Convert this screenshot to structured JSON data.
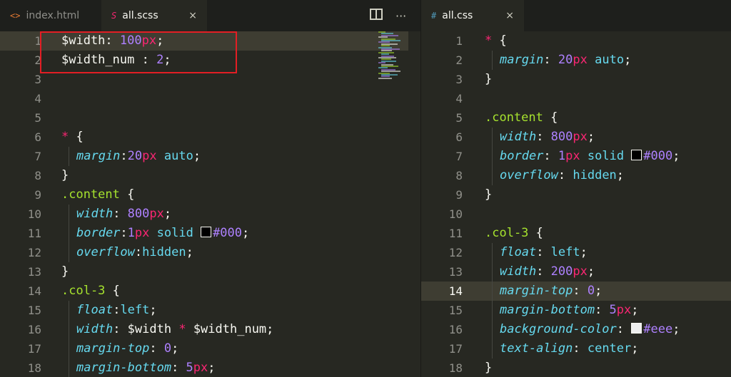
{
  "left_tabs": [
    {
      "icon": "<>",
      "label": "index.html",
      "active": false
    },
    {
      "icon": "S",
      "label": "all.scss",
      "active": true,
      "close": "×"
    }
  ],
  "left_actions": {
    "split": "split-editor-icon",
    "more": "···"
  },
  "right_tabs": [
    {
      "icon": "#",
      "label": "all.css",
      "active": true,
      "close": "×"
    }
  ],
  "colors": {
    "background": "#272822",
    "highlight_box": "#e31e24",
    "property": "#66d9ef",
    "selector": "#a6e22e",
    "number": "#ae81ff",
    "unit": "#f92672"
  },
  "left_editor": {
    "lines": [
      {
        "n": "1",
        "tokens": [
          [
            "var",
            "$width"
          ],
          [
            "punc",
            ": "
          ],
          [
            "num",
            "100"
          ],
          [
            "unit",
            "px"
          ],
          [
            "punc",
            ";"
          ]
        ],
        "indent": 0,
        "highlight": true
      },
      {
        "n": "2",
        "tokens": [
          [
            "var",
            "$width_num"
          ],
          [
            "punc",
            " : "
          ],
          [
            "num",
            "2"
          ],
          [
            "punc",
            ";"
          ]
        ],
        "indent": 0
      },
      {
        "n": "3",
        "tokens": [],
        "indent": 0
      },
      {
        "n": "4",
        "tokens": [],
        "indent": 0
      },
      {
        "n": "5",
        "tokens": [],
        "indent": 0
      },
      {
        "n": "6",
        "tokens": [
          [
            "star",
            "*"
          ],
          [
            "punc",
            " {"
          ]
        ],
        "indent": 0
      },
      {
        "n": "7",
        "tokens": [
          [
            "prop",
            "margin"
          ],
          [
            "punc",
            ":"
          ],
          [
            "num",
            "20"
          ],
          [
            "unit",
            "px"
          ],
          [
            "val",
            " auto"
          ],
          [
            "punc",
            ";"
          ]
        ],
        "indent": 1
      },
      {
        "n": "8",
        "tokens": [
          [
            "punc",
            "}"
          ]
        ],
        "indent": 0
      },
      {
        "n": "9",
        "tokens": [
          [
            "sel",
            ".content"
          ],
          [
            "punc",
            " {"
          ]
        ],
        "indent": 0
      },
      {
        "n": "10",
        "tokens": [
          [
            "prop",
            "width"
          ],
          [
            "punc",
            ": "
          ],
          [
            "num",
            "800"
          ],
          [
            "unit",
            "px"
          ],
          [
            "punc",
            ";"
          ]
        ],
        "indent": 1
      },
      {
        "n": "11",
        "tokens": [
          [
            "prop",
            "border"
          ],
          [
            "punc",
            ":"
          ],
          [
            "num",
            "1"
          ],
          [
            "unit",
            "px"
          ],
          [
            "val",
            " solid "
          ],
          [
            "swatch",
            "#000"
          ],
          [
            "num",
            "#000"
          ],
          [
            "punc",
            ";"
          ]
        ],
        "indent": 1
      },
      {
        "n": "12",
        "tokens": [
          [
            "prop",
            "overflow"
          ],
          [
            "punc",
            ":"
          ],
          [
            "val",
            "hidden"
          ],
          [
            "punc",
            ";"
          ]
        ],
        "indent": 1
      },
      {
        "n": "13",
        "tokens": [
          [
            "punc",
            "}"
          ]
        ],
        "indent": 0
      },
      {
        "n": "14",
        "tokens": [
          [
            "sel",
            ".col-3"
          ],
          [
            "punc",
            " {"
          ]
        ],
        "indent": 0
      },
      {
        "n": "15",
        "tokens": [
          [
            "prop",
            "float"
          ],
          [
            "punc",
            ":"
          ],
          [
            "val",
            "left"
          ],
          [
            "punc",
            ";"
          ]
        ],
        "indent": 1
      },
      {
        "n": "16",
        "tokens": [
          [
            "prop",
            "width"
          ],
          [
            "punc",
            ": "
          ],
          [
            "var",
            "$width"
          ],
          [
            "op",
            " * "
          ],
          [
            "var",
            "$width_num"
          ],
          [
            "punc",
            ";"
          ]
        ],
        "indent": 1
      },
      {
        "n": "17",
        "tokens": [
          [
            "prop",
            "margin-top"
          ],
          [
            "punc",
            ": "
          ],
          [
            "num",
            "0"
          ],
          [
            "punc",
            ";"
          ]
        ],
        "indent": 1
      },
      {
        "n": "18",
        "tokens": [
          [
            "prop",
            "margin-bottom"
          ],
          [
            "punc",
            ": "
          ],
          [
            "num",
            "5"
          ],
          [
            "unit",
            "px"
          ],
          [
            "punc",
            ";"
          ]
        ],
        "indent": 1
      }
    ]
  },
  "right_editor": {
    "lines": [
      {
        "n": "1",
        "tokens": [
          [
            "star",
            "*"
          ],
          [
            "punc",
            " {"
          ]
        ],
        "indent": 0
      },
      {
        "n": "2",
        "tokens": [
          [
            "prop",
            "margin"
          ],
          [
            "punc",
            ": "
          ],
          [
            "num",
            "20"
          ],
          [
            "unit",
            "px"
          ],
          [
            "val",
            " auto"
          ],
          [
            "punc",
            ";"
          ]
        ],
        "indent": 1
      },
      {
        "n": "3",
        "tokens": [
          [
            "punc",
            "}"
          ]
        ],
        "indent": 0
      },
      {
        "n": "4",
        "tokens": [],
        "indent": 0
      },
      {
        "n": "5",
        "tokens": [
          [
            "sel",
            ".content"
          ],
          [
            "punc",
            " {"
          ]
        ],
        "indent": 0
      },
      {
        "n": "6",
        "tokens": [
          [
            "prop",
            "width"
          ],
          [
            "punc",
            ": "
          ],
          [
            "num",
            "800"
          ],
          [
            "unit",
            "px"
          ],
          [
            "punc",
            ";"
          ]
        ],
        "indent": 1
      },
      {
        "n": "7",
        "tokens": [
          [
            "prop",
            "border"
          ],
          [
            "punc",
            ": "
          ],
          [
            "num",
            "1"
          ],
          [
            "unit",
            "px"
          ],
          [
            "val",
            " solid "
          ],
          [
            "swatch",
            "#000"
          ],
          [
            "num",
            "#000"
          ],
          [
            "punc",
            ";"
          ]
        ],
        "indent": 1
      },
      {
        "n": "8",
        "tokens": [
          [
            "prop",
            "overflow"
          ],
          [
            "punc",
            ": "
          ],
          [
            "val",
            "hidden"
          ],
          [
            "punc",
            ";"
          ]
        ],
        "indent": 1
      },
      {
        "n": "9",
        "tokens": [
          [
            "punc",
            "}"
          ]
        ],
        "indent": 0
      },
      {
        "n": "10",
        "tokens": [],
        "indent": 0
      },
      {
        "n": "11",
        "tokens": [
          [
            "sel",
            ".col-3"
          ],
          [
            "punc",
            " {"
          ]
        ],
        "indent": 0
      },
      {
        "n": "12",
        "tokens": [
          [
            "prop",
            "float"
          ],
          [
            "punc",
            ": "
          ],
          [
            "val",
            "left"
          ],
          [
            "punc",
            ";"
          ]
        ],
        "indent": 1
      },
      {
        "n": "13",
        "tokens": [
          [
            "prop",
            "width"
          ],
          [
            "punc",
            ": "
          ],
          [
            "num",
            "200"
          ],
          [
            "unit",
            "px"
          ],
          [
            "punc",
            ";"
          ]
        ],
        "indent": 1
      },
      {
        "n": "14",
        "tokens": [
          [
            "prop",
            "margin-top"
          ],
          [
            "punc",
            ": "
          ],
          [
            "num",
            "0"
          ],
          [
            "punc",
            ";"
          ]
        ],
        "indent": 1,
        "highlight": true,
        "current": true
      },
      {
        "n": "15",
        "tokens": [
          [
            "prop",
            "margin-bottom"
          ],
          [
            "punc",
            ": "
          ],
          [
            "num",
            "5"
          ],
          [
            "unit",
            "px"
          ],
          [
            "punc",
            ";"
          ]
        ],
        "indent": 1
      },
      {
        "n": "16",
        "tokens": [
          [
            "prop",
            "background-color"
          ],
          [
            "punc",
            ": "
          ],
          [
            "swatch",
            "#eee"
          ],
          [
            "num",
            "#eee"
          ],
          [
            "punc",
            ";"
          ]
        ],
        "indent": 1
      },
      {
        "n": "17",
        "tokens": [
          [
            "prop",
            "text-align"
          ],
          [
            "punc",
            ": "
          ],
          [
            "val",
            "center"
          ],
          [
            "punc",
            ";"
          ]
        ],
        "indent": 1
      },
      {
        "n": "18",
        "tokens": [
          [
            "punc",
            "}"
          ]
        ],
        "indent": 0
      }
    ]
  }
}
